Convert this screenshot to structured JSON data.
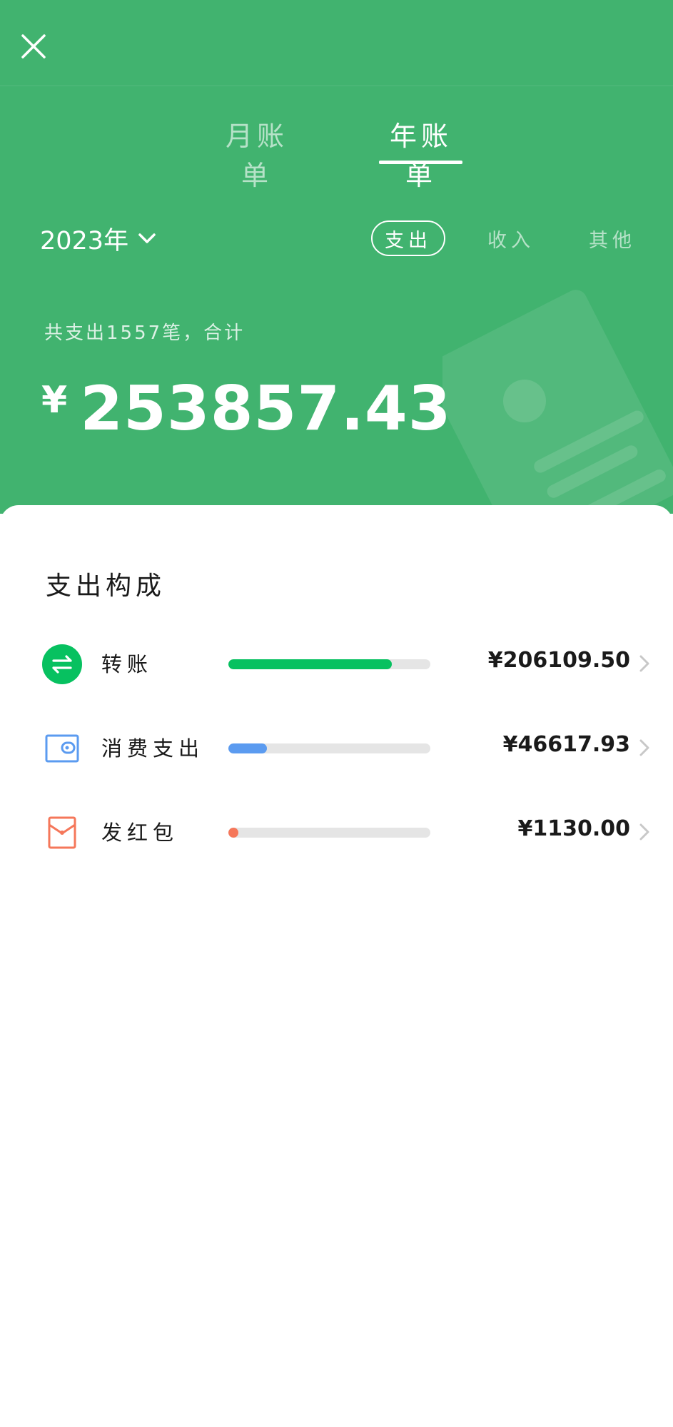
{
  "header": {
    "close_icon": "close-icon",
    "tabs": [
      {
        "label": "月账单",
        "active": false
      },
      {
        "label": "年账单",
        "active": true
      }
    ],
    "year": {
      "label": "2023年",
      "icon": "chevron-down-icon"
    },
    "filters": [
      {
        "label": "支出",
        "active": true
      },
      {
        "label": "收入",
        "active": false
      },
      {
        "label": "其他",
        "active": false
      }
    ],
    "summary_text": "共支出1557笔，合计",
    "total": {
      "currency": "¥",
      "value": "253857.43"
    },
    "colors": {
      "background": "#41b36f",
      "text": "#ffffff"
    }
  },
  "composition": {
    "title": "支出构成",
    "categories": [
      {
        "label": "转账",
        "amount": "¥206109.50",
        "share": 0.81,
        "color": "#07c160",
        "icon": "transfer-icon"
      },
      {
        "label": "消费支出",
        "amount": "¥46617.93",
        "share": 0.19,
        "color": "#5b9bf0",
        "icon": "wallet-icon"
      },
      {
        "label": "发红包",
        "amount": "¥1130.00",
        "share": 0.005,
        "color": "#f5775a",
        "icon": "red-packet-icon"
      }
    ]
  }
}
